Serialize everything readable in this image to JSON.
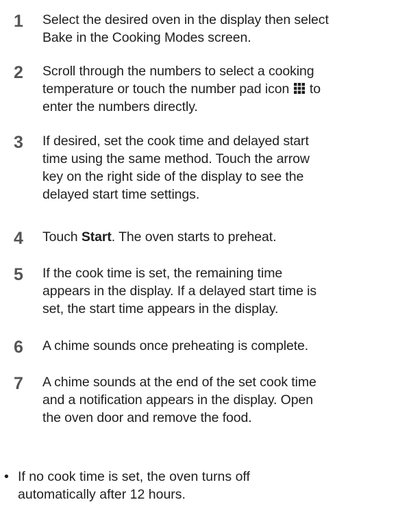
{
  "steps": [
    {
      "number": "1",
      "lines": [
        "Select the desired oven in the display then select",
        "Bake in the Cooking Modes screen."
      ]
    },
    {
      "number": "2",
      "line1": "Scroll through the numbers to select a cooking",
      "line2_before": "temperature or touch the number pad icon",
      "line2_after": "to",
      "line3": "enter the numbers directly.",
      "icon": "number-pad-icon"
    },
    {
      "number": "3",
      "lines": [
        "If desired, set the cook time and delayed start",
        "time using the same method. Touch the arrow",
        "key on the right side of the display to see the",
        "delayed start time settings."
      ]
    },
    {
      "number": "4",
      "prefix": "Touch ",
      "bold": "Start",
      "suffix": ". The oven starts to preheat."
    },
    {
      "number": "5",
      "lines": [
        "If the cook time is set, the remaining time",
        "appears in the display. If a delayed start time is",
        "set, the start time appears in the display."
      ]
    },
    {
      "number": "6",
      "lines": [
        "A chime sounds once preheating is complete."
      ]
    },
    {
      "number": "7",
      "lines": [
        "A chime sounds at the end of the set cook time",
        "and a notification appears in the display. Open",
        "the oven door and remove the food."
      ]
    }
  ],
  "note": {
    "bullet": "•",
    "lines": [
      "If no cook time is set, the oven turns off",
      "automatically after 12 hours."
    ]
  },
  "colors": {
    "text": "#1f1f1f",
    "step_number": "#555555",
    "icon": "#1f1f1f"
  }
}
